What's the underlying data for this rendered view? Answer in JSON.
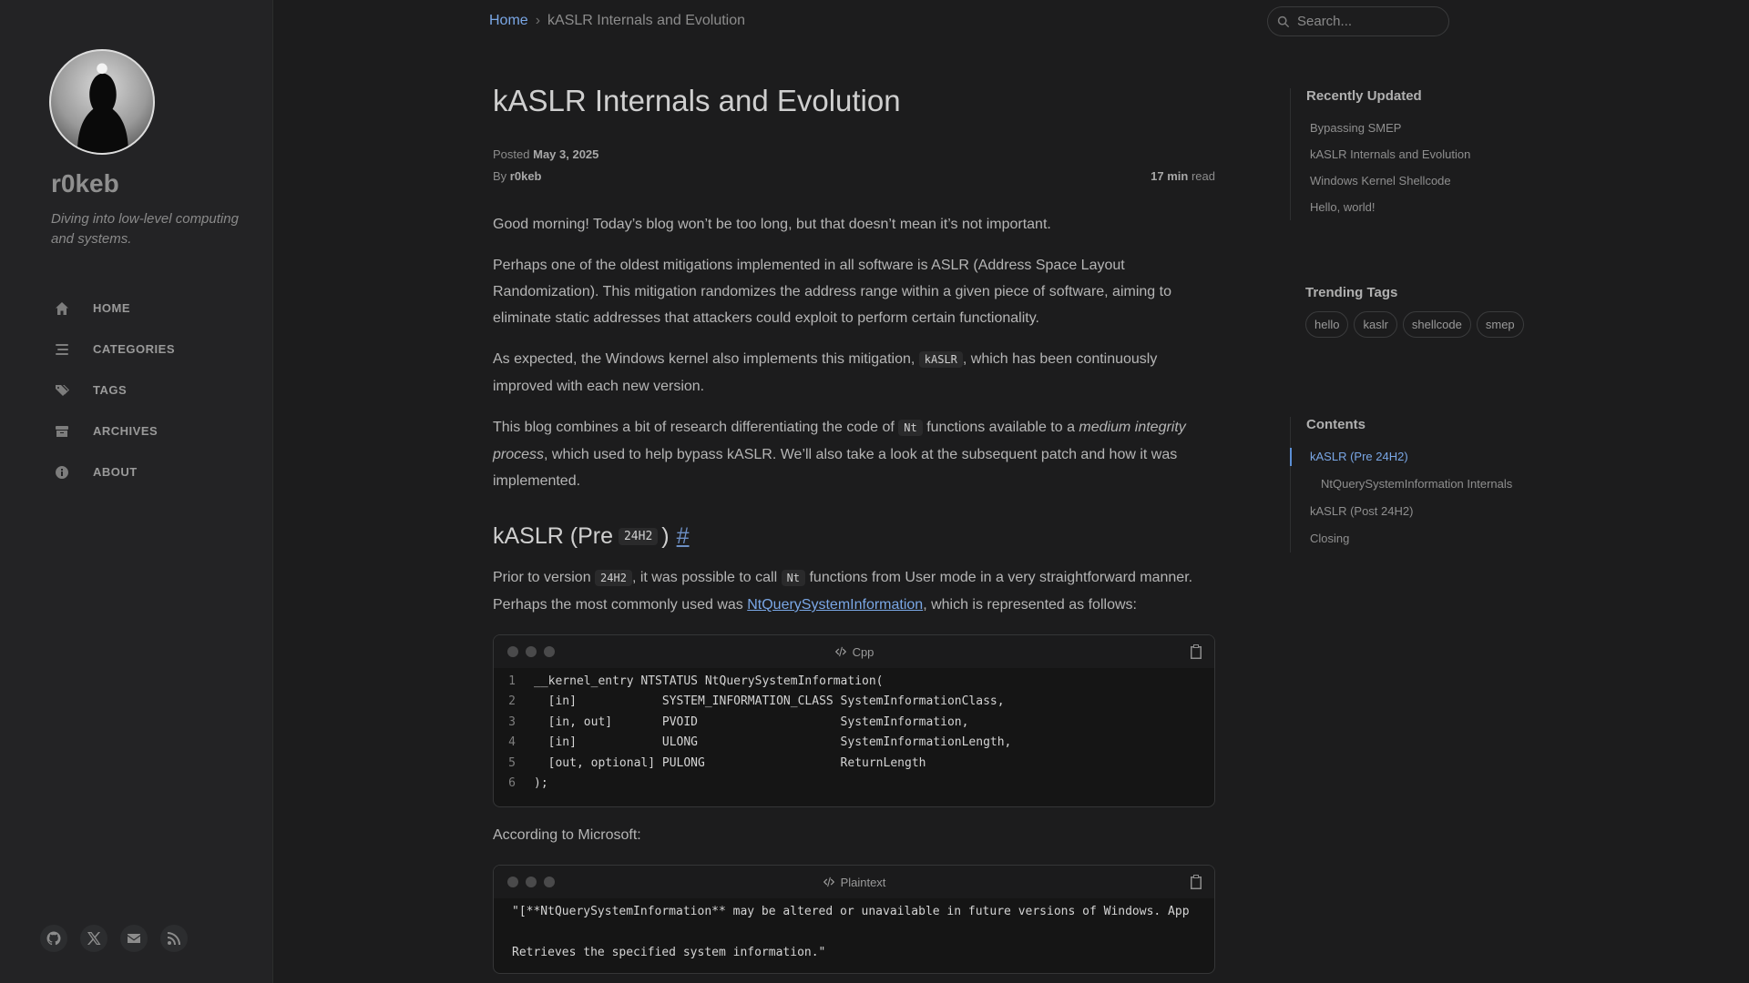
{
  "sidebar": {
    "title": "r0keb",
    "subtitle": "Diving into low-level computing and systems.",
    "nav": [
      {
        "label": "HOME",
        "icon": "home-icon"
      },
      {
        "label": "CATEGORIES",
        "icon": "stream-icon"
      },
      {
        "label": "TAGS",
        "icon": "tags-icon"
      },
      {
        "label": "ARCHIVES",
        "icon": "archive-icon"
      },
      {
        "label": "ABOUT",
        "icon": "info-circle-icon"
      }
    ],
    "social": [
      "github-icon",
      "x-twitter-icon",
      "email-icon",
      "rss-icon"
    ]
  },
  "topbar": {
    "breadcrumb_home": "Home",
    "breadcrumb_sep": "›",
    "breadcrumb_current": "kASLR Internals and Evolution",
    "search_placeholder": "Search..."
  },
  "post": {
    "title": "kASLR Internals and Evolution",
    "posted_label": "Posted",
    "posted_date": "May 3, 2025",
    "by_label": "By",
    "author": "r0keb",
    "read_time": "17 min",
    "read_label": "read",
    "p1": "Good morning! Today’s blog won’t be too long, but that doesn’t mean it’s not important.",
    "p2": "Perhaps one of the oldest mitigations implemented in all software is ASLR (Address Space Layout Randomization). This mitigation randomizes the address range within a given piece of software, aiming to eliminate static addresses that attackers could exploit to perform certain functionality.",
    "p3_a": "As expected, the Windows kernel also implements this mitigation, ",
    "p3_code": "kASLR",
    "p3_b": ", which has been continuously improved with each new version.",
    "p4_a": "This blog combines a bit of research differentiating the code of ",
    "p4_code": "Nt",
    "p4_b": " functions available to a ",
    "p4_em": "medium integrity process",
    "p4_c": ", which used to help bypass kASLR. We’ll also take a look at the subsequent patch and how it was implemented.",
    "h2_a": "kASLR (Pre",
    "h2_code": "24H2",
    "h2_b": ")",
    "h2_anchor": "#",
    "p5_a": "Prior to version ",
    "p5_code1": "24H2",
    "p5_b": ", it was possible to call ",
    "p5_code2": "Nt",
    "p5_c": " functions from User mode in a very straightforward manner. Perhaps the most commonly used was ",
    "p5_link": "NtQuerySystemInformation",
    "p5_d": ", which is represented as follows:",
    "code1_lang": "Cpp",
    "code1_lines": [
      {
        "n": "1",
        "t": "__kernel_entry NTSTATUS NtQuerySystemInformation("
      },
      {
        "n": "2",
        "t": "  [in]            SYSTEM_INFORMATION_CLASS SystemInformationClass,"
      },
      {
        "n": "3",
        "t": "  [in, out]       PVOID                    SystemInformation,"
      },
      {
        "n": "4",
        "t": "  [in]            ULONG                    SystemInformationLength,"
      },
      {
        "n": "5",
        "t": "  [out, optional] PULONG                   ReturnLength"
      },
      {
        "n": "6",
        "t": ");"
      }
    ],
    "p6": "According to Microsoft:",
    "code2_lang": "Plaintext",
    "code2_line1": "\"[**NtQuerySystemInformation** may be altered or unavailable in future versions of Windows. App",
    "code2_line2": "",
    "code2_line3": "Retrieves the specified system information.\""
  },
  "panel": {
    "recent_title": "Recently Updated",
    "recent": [
      "Bypassing SMEP",
      "kASLR Internals and Evolution",
      "Windows Kernel Shellcode",
      "Hello, world!"
    ],
    "tags_title": "Trending Tags",
    "tags": [
      "hello",
      "kaslr",
      "shellcode",
      "smep"
    ],
    "toc_title": "Contents",
    "toc": [
      "kASLR (Pre 24H2)",
      "NtQuerySystemInformation Internals",
      "kASLR (Post 24H2)",
      "Closing"
    ]
  }
}
